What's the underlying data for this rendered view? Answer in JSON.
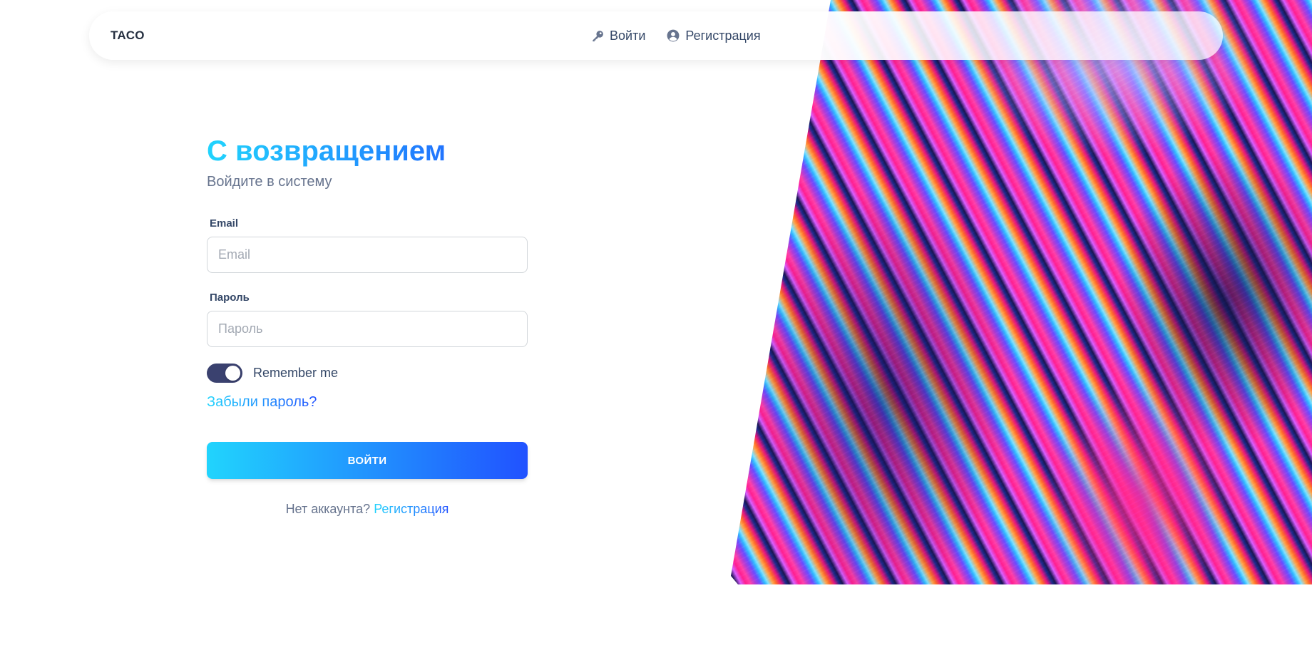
{
  "navbar": {
    "brand": "TACO",
    "login_label": "Войти",
    "login_icon": "key-icon",
    "register_label": "Регистрация",
    "register_icon": "user-circle-icon"
  },
  "login": {
    "title": "С возвращением",
    "subtitle": "Войдите в систему",
    "email_label": "Email",
    "email_placeholder": "Email",
    "email_value": "",
    "password_label": "Пароль",
    "password_placeholder": "Пароль",
    "password_value": "",
    "remember_label": "Remember me",
    "remember_checked": true,
    "forgot_label": "Забыли пароль?",
    "submit_label": "ВОЙТИ",
    "no_account_text": "Нет аккаунта?",
    "signup_label": "Регистрация"
  },
  "colors": {
    "gradient_start": "#21d4fd",
    "gradient_end": "#2152ff",
    "toggle_on": "#3a416f",
    "text_dark": "#344767",
    "text_muted": "#67748e"
  }
}
